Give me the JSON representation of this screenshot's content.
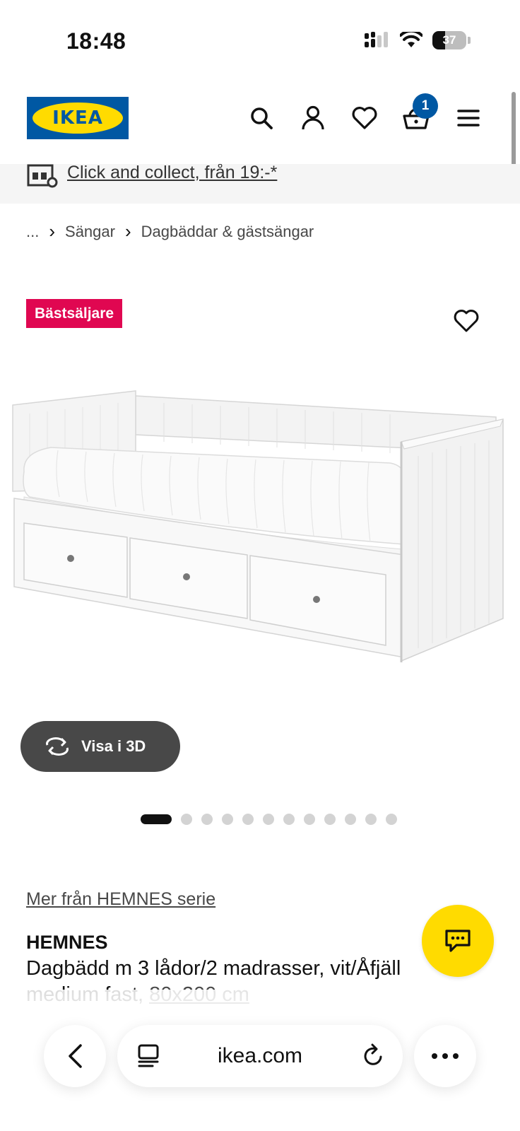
{
  "status_bar": {
    "time": "18:48",
    "battery_level": "37",
    "battery_fraction": 0.37
  },
  "header": {
    "logo_text": "IKEA",
    "icons": [
      "search-icon",
      "account-icon",
      "heart-icon",
      "cart-icon",
      "menu-icon"
    ],
    "cart_count": "1"
  },
  "collect_banner": {
    "text": "Click and collect, från 19:-*"
  },
  "breadcrumb": {
    "items": [
      "...",
      "Sängar",
      "Dagbäddar & gästsängar"
    ]
  },
  "product": {
    "badge": "Bästsäljare",
    "view_3d_label": "Visa i 3D",
    "image_count": 12,
    "active_image_index": 0,
    "series_link": "Mer från HEMNES serie",
    "name": "HEMNES",
    "description": "Dagbädd m 3 lådor/2 madrasser, vit/Åfjäll medium fast, ",
    "size": "80x200 cm"
  },
  "browser": {
    "url": "ikea.com"
  },
  "colors": {
    "ikea_blue": "#0058a3",
    "ikea_yellow": "#ffdb00",
    "badge_red": "#e00751",
    "button_dark": "#484848"
  }
}
